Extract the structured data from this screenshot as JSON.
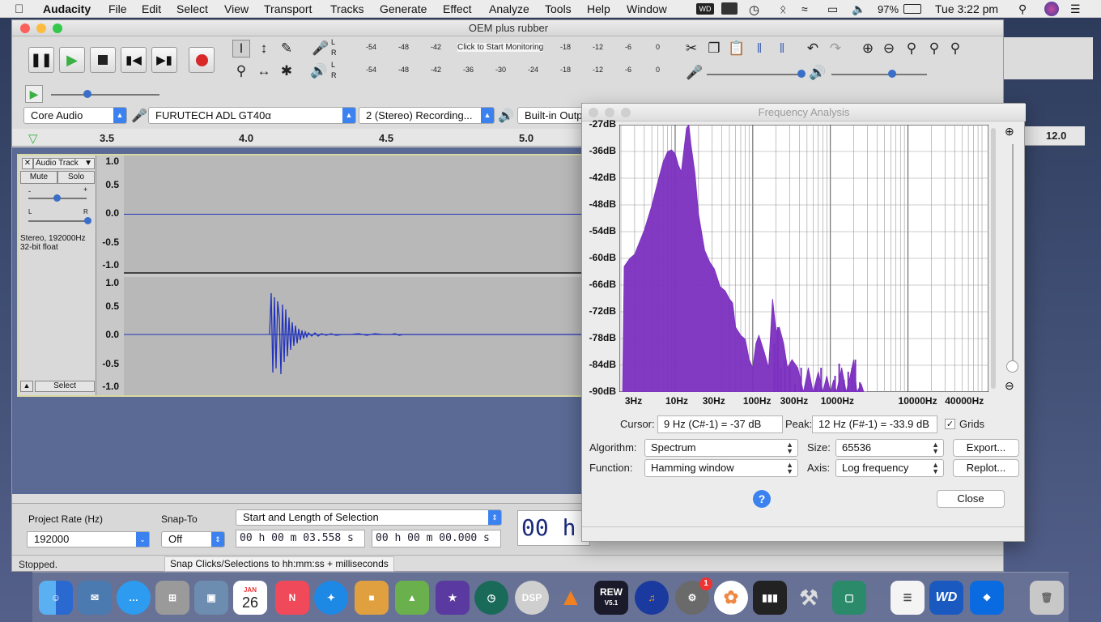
{
  "menubar": {
    "app": "Audacity",
    "items": [
      "File",
      "Edit",
      "Select",
      "View",
      "Transport",
      "Tracks",
      "Generate",
      "Effect",
      "Analyze",
      "Tools",
      "Help",
      "Window"
    ],
    "battery": "97%",
    "clock": "Tue 3:22 pm"
  },
  "audacity": {
    "title": "OEM plus rubber",
    "meter_ticks": [
      "-54",
      "-48",
      "-42",
      "-18",
      "-12",
      "-6",
      "0"
    ],
    "meter_ticks_play": [
      "-54",
      "-48",
      "-42",
      "-36",
      "-30",
      "-24",
      "-18",
      "-12",
      "-6",
      "0"
    ],
    "monitor_text": "Click to Start Monitoring",
    "meter_lr": [
      "L",
      "R"
    ],
    "device_host": "Core Audio",
    "device_input": "FURUTECH ADL GT40α",
    "device_channels": "2 (Stereo) Recording...",
    "device_output": "Built-in Outp",
    "ruler_labels": [
      "3.5",
      "4.0",
      "4.5",
      "5.0",
      "12.0"
    ],
    "track": {
      "name": "Audio Track",
      "mute": "Mute",
      "solo": "Solo",
      "info": "Stereo, 192000Hz\n32-bit float",
      "select": "Select",
      "gain_marks": [
        "-",
        "+"
      ],
      "pan_marks": [
        "L",
        "R"
      ],
      "scale": [
        "1.0",
        "0.5",
        "0.0",
        "-0.5",
        "-1.0"
      ]
    },
    "selection": {
      "rate_label": "Project Rate (Hz)",
      "rate_value": "192000",
      "snap_label": "Snap-To",
      "snap_value": "Off",
      "mode": "Start and Length of Selection",
      "start": "00 h 00 m 03.558 s",
      "length": "00 h 00 m 00.000 s",
      "big_time": "00 h"
    },
    "status": "Stopped.",
    "tooltip": "Snap Clicks/Selections to hh:mm:ss + milliseconds"
  },
  "freq_dialog": {
    "title": "Frequency Analysis",
    "db_labels": [
      "-27dB",
      "-36dB",
      "-42dB",
      "-48dB",
      "-54dB",
      "-60dB",
      "-66dB",
      "-72dB",
      "-78dB",
      "-84dB",
      "-90dB"
    ],
    "hz_labels": [
      "3Hz",
      "10Hz",
      "30Hz",
      "100Hz",
      "300Hz",
      "1000Hz",
      "10000Hz",
      "40000Hz"
    ],
    "cursor_label": "Cursor:",
    "cursor_value": "9 Hz (C#-1) = -37 dB",
    "peak_label": "Peak:",
    "peak_value": "12 Hz (F#-1) = -33.9 dB",
    "grids_label": "Grids",
    "grids_checked": true,
    "algorithm_label": "Algorithm:",
    "algorithm_value": "Spectrum",
    "size_label": "Size:",
    "size_value": "65536",
    "export_label": "Export...",
    "function_label": "Function:",
    "function_value": "Hamming window",
    "axis_label": "Axis:",
    "axis_value": "Log frequency",
    "replot_label": "Replot...",
    "help_label": "?",
    "close_label": "Close",
    "spectrum_color": "#7b2fbf"
  },
  "dock": {
    "calendar_month": "JAN",
    "calendar_day": "26",
    "rew_label": "REW",
    "rew_version": "V5.1",
    "settings_badge": "1",
    "dsp_label": "DSP",
    "wd_label": "WD"
  }
}
